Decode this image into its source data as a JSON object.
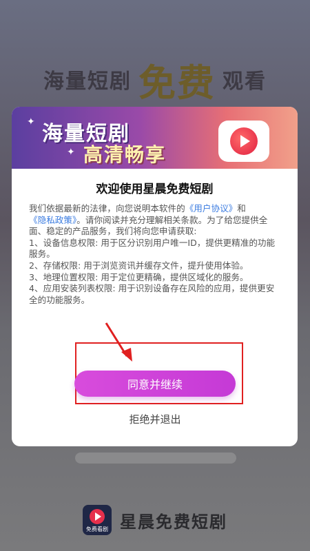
{
  "background": {
    "banner_left": "海量短剧",
    "banner_mid": "免费",
    "banner_right": "观看"
  },
  "dialog": {
    "header_line1": "海量短剧",
    "header_line2": "高清畅享",
    "title": "欢迎使用星晨免费短剧",
    "body_prefix": "我们依据最新的法律，向您说明本软件的",
    "user_agreement": "《用户协议》",
    "body_and": "和",
    "privacy_policy": "《隐私政策》",
    "body_intro": "。请你阅读并充分理解相关条款。为了给您提供全面、稳定的产品服务，我们将向您申请获取:",
    "perm1": "1、设备信息权限: 用于区分识别用户唯一ID，提供更精准的功能服务。",
    "perm2": "2、存储权限: 用于浏览资讯并缓存文件，提升使用体验。",
    "perm3": "3、地理位置权限: 用于定位更精确，提供区域化的服务。",
    "perm4": "4、应用安装列表权限: 用于识别设备存在风险的应用，提供更安全的功能服务。",
    "agree_button": "同意并继续",
    "refuse_link": "拒绝并退出"
  },
  "footer": {
    "logo_label": "免费看剧",
    "app_name": "星晨免费短剧"
  },
  "colors": {
    "agree_button": "#d84cdc",
    "link": "#3a7be0",
    "highlight_box": "#e02020"
  }
}
